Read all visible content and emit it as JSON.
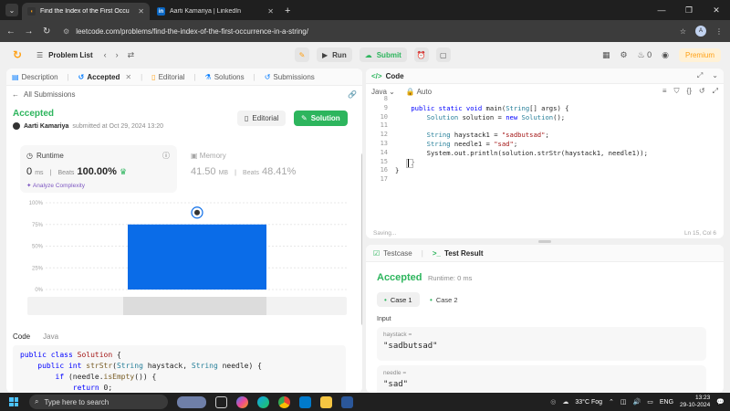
{
  "browser": {
    "tabs": [
      {
        "title": "Find the Index of the First Occu",
        "active": true
      },
      {
        "title": "Aarti Kamariya | LinkedIn",
        "active": false
      }
    ],
    "url": "leetcode.com/problems/find-the-index-of-the-first-occurrence-in-a-string/",
    "profile_letter": "A"
  },
  "lcnav": {
    "problem_list": "Problem List",
    "run": "Run",
    "submit": "Submit",
    "streak": "0",
    "premium": "Premium"
  },
  "left": {
    "tabs": [
      "Description",
      "Accepted",
      "Editorial",
      "Solutions",
      "Submissions"
    ],
    "all_submissions": "All Submissions",
    "status": "Accepted",
    "author": "Aarti Kamariya",
    "submitted_at": "submitted at Oct 29, 2024 13:20",
    "editorial_btn": "Editorial",
    "solution_btn": "Solution",
    "runtime": {
      "label": "Runtime",
      "value": "0",
      "unit": "ms",
      "beats_label": "Beats",
      "beats": "100.00%",
      "analyze": "Analyze Complexity"
    },
    "memory": {
      "label": "Memory",
      "value": "41.50",
      "unit": "MB",
      "beats_label": "Beats",
      "beats": "48.41%"
    },
    "code_label": "Code",
    "code_lang": "Java",
    "code_lines": [
      "public class Solution {",
      "    public int strStr(String haystack, String needle) {",
      "        if (needle.isEmpty()) {",
      "            return 0;"
    ]
  },
  "chart_data": {
    "type": "bar",
    "categories": [
      "0ms"
    ],
    "values": [
      75
    ],
    "ylim": [
      0,
      100
    ],
    "y_ticks": [
      "100%",
      "75%",
      "50%",
      "25%",
      "0%"
    ],
    "bar_color": "#0a6ce8"
  },
  "editor": {
    "title": "Code",
    "lang": "Java",
    "mode": "Auto",
    "lines": [
      {
        "n": "8",
        "t": ""
      },
      {
        "n": "9",
        "t": "    public static void main(String[] args) {"
      },
      {
        "n": "10",
        "t": "        Solution solution = new Solution();"
      },
      {
        "n": "11",
        "t": ""
      },
      {
        "n": "12",
        "t": "        String haystack1 = \"sadbutsad\";"
      },
      {
        "n": "13",
        "t": "        String needle1 = \"sad\";"
      },
      {
        "n": "14",
        "t": "        System.out.println(solution.strStr(haystack1, needle1));"
      },
      {
        "n": "15",
        "t": "    }"
      },
      {
        "n": "16",
        "t": "}"
      },
      {
        "n": "17",
        "t": ""
      }
    ],
    "saving": "Saving...",
    "cursor": "Ln 15, Col 6"
  },
  "test": {
    "testcase_tab": "Testcase",
    "result_tab": "Test Result",
    "status": "Accepted",
    "runtime": "Runtime: 0 ms",
    "cases": [
      "Case 1",
      "Case 2"
    ],
    "input_label": "Input",
    "vars": [
      {
        "name": "haystack =",
        "value": "\"sadbutsad\""
      },
      {
        "name": "needle =",
        "value": "\"sad\""
      }
    ]
  },
  "taskbar": {
    "search_placeholder": "Type here to search",
    "weather": "33°C  Fog",
    "lang": "ENG",
    "time": "13:23",
    "date": "29-10-2024"
  }
}
